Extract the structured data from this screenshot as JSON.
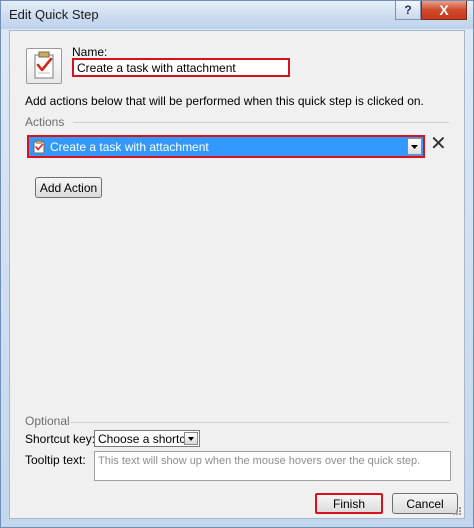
{
  "window": {
    "title": "Edit Quick Step",
    "help_label": "?",
    "close_label": "X"
  },
  "name_field": {
    "label": "Name:",
    "value": "Create a task with attachment"
  },
  "description": "Add actions below that will be performed when this quick step is clicked on.",
  "actions": {
    "section_label": "Actions",
    "selected_action": "Create a task with attachment",
    "remove_label": "✕",
    "add_button_label": "Add Action"
  },
  "optional": {
    "section_label": "Optional",
    "shortcut_label": "Shortcut key:",
    "shortcut_value": "Choose a shortcut",
    "tooltip_label": "Tooltip text:",
    "tooltip_placeholder": "This text will show up when the mouse hovers over the quick step."
  },
  "footer": {
    "finish_label": "Finish",
    "cancel_label": "Cancel"
  },
  "colors": {
    "highlight_red": "#d6121f",
    "selection_blue": "#3399ff"
  }
}
